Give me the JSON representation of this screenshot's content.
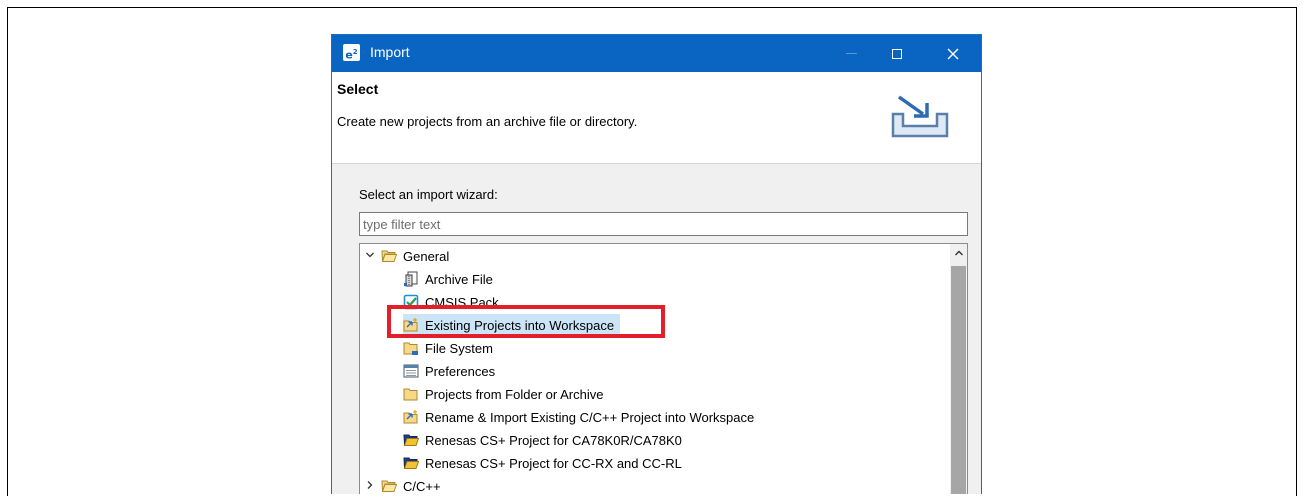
{
  "dialog": {
    "title": "Import",
    "app_icon": "e²"
  },
  "header": {
    "title": "Select",
    "description": "Create new projects from an archive file or directory.",
    "icon": "import-wizard-icon"
  },
  "wizard": {
    "label": "Select an import wizard:",
    "filter_placeholder": "type filter text",
    "filter_value": ""
  },
  "tree": {
    "groups": [
      {
        "label": "General",
        "expanded": true,
        "items": [
          {
            "label": "Archive File",
            "icon": "archive-file-icon"
          },
          {
            "label": "CMSIS Pack",
            "icon": "cmsis-pack-icon"
          },
          {
            "label": "Existing Projects into Workspace",
            "icon": "existing-projects-icon",
            "selected": true
          },
          {
            "label": "File System",
            "icon": "file-system-icon"
          },
          {
            "label": "Preferences",
            "icon": "preferences-icon"
          },
          {
            "label": "Projects from Folder or Archive",
            "icon": "projects-folder-icon"
          },
          {
            "label": "Rename & Import Existing C/C++ Project into Workspace",
            "icon": "rename-import-icon"
          },
          {
            "label": "Renesas CS+ Project for CA78K0R/CA78K0",
            "icon": "renesas-folder-icon"
          },
          {
            "label": "Renesas CS+ Project for CC-RX and CC-RL",
            "icon": "renesas-folder-icon"
          }
        ]
      },
      {
        "label": "C/C++",
        "expanded": false
      }
    ]
  },
  "colors": {
    "titlebar": "#0a64c2",
    "highlight": "#e3202a",
    "selection": "#cce4f7"
  }
}
